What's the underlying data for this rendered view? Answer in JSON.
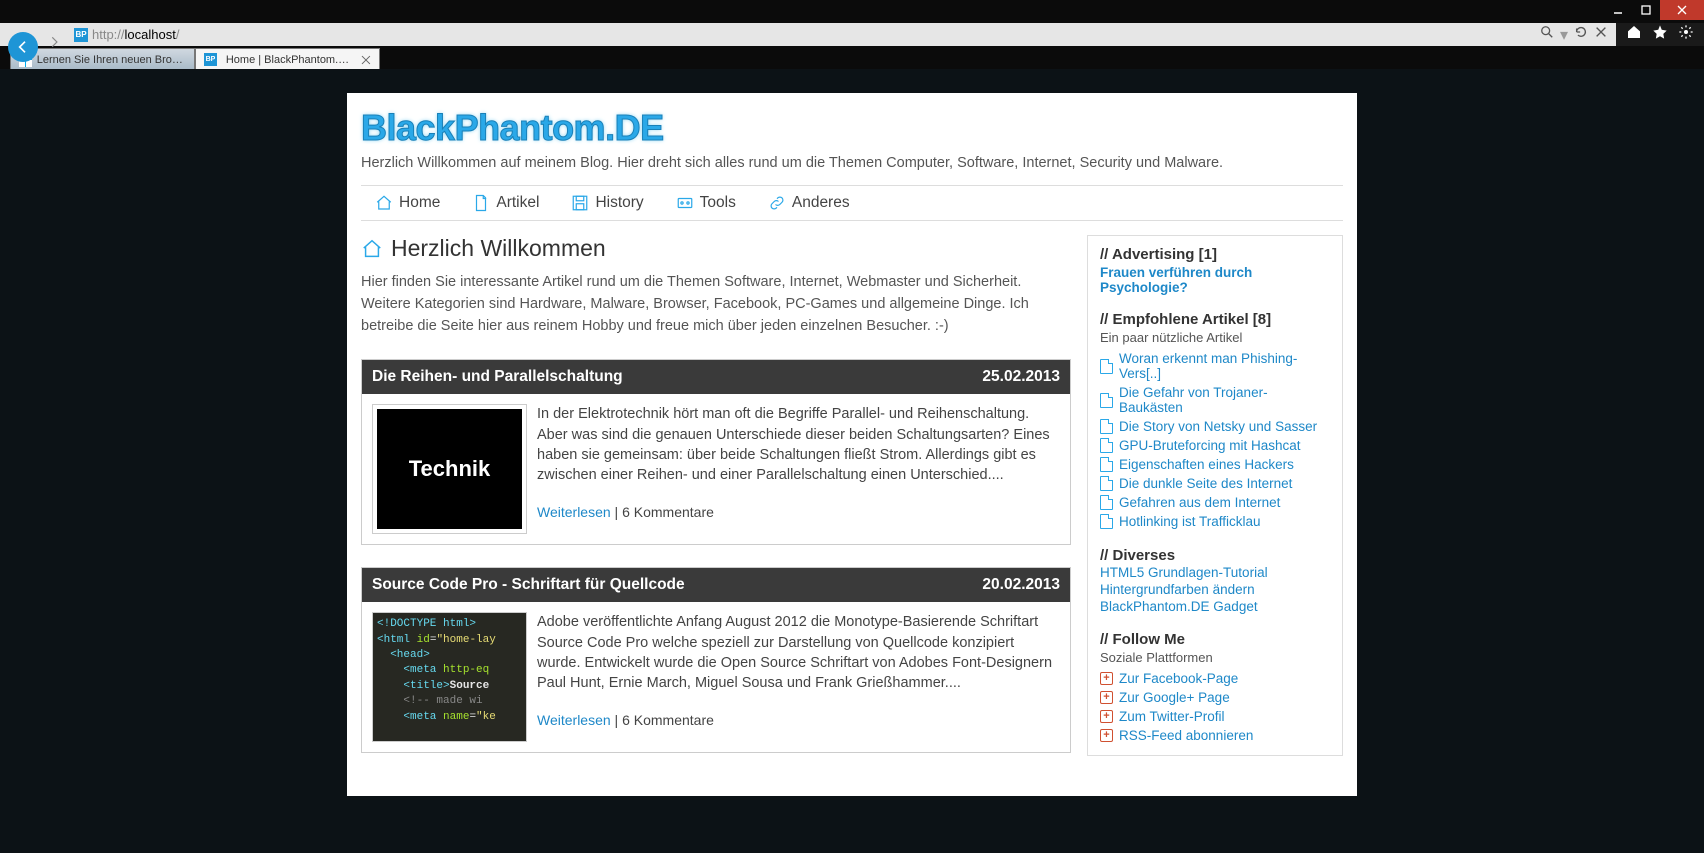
{
  "browser": {
    "url_prefix": "http://",
    "url_host": "localhost",
    "url_suffix": "/",
    "tabs": [
      {
        "label": "Lernen Sie Ihren neuen Browse..."
      },
      {
        "label": "Home | BlackPhantom.DE"
      }
    ],
    "favicon_text": "BP"
  },
  "site": {
    "title": "BlackPhantom.DE",
    "tagline": "Herzlich Willkommen auf meinem Blog. Hier dreht sich alles rund um die Themen Computer, Software, Internet, Security und Malware."
  },
  "nav": {
    "home": "Home",
    "artikel": "Artikel",
    "history": "History",
    "tools": "Tools",
    "anderes": "Anderes"
  },
  "welcome": {
    "heading": "Herzlich Willkommen",
    "text": "Hier finden Sie interessante Artikel rund um die Themen Software, Internet, Webmaster und Sicherheit. Weitere Kategorien sind Hardware, Malware, Browser, Facebook, PC-Games und allgemeine Dinge. Ich betreibe die Seite hier aus reinem Hobby und freue mich über jeden einzelnen Besucher. :-)"
  },
  "articles": [
    {
      "title": "Die Reihen- und Parallelschaltung",
      "date": "25.02.2013",
      "thumb_label": "Technik",
      "excerpt": "In der Elektrotechnik hört man oft die Begriffe Parallel- und Reihenschaltung. Aber was sind die genauen Unterschiede dieser beiden Schaltungsarten? Eines haben sie gemeinsam: über beide Schaltungen fließt Strom. Allerdings gibt es zwischen einer Reihen- und einer Parallel­schaltung einen Unterschied....",
      "more": "Weiterlesen",
      "comments": "6 Kommentare"
    },
    {
      "title": "Source Code Pro - Schriftart für Quellcode",
      "date": "20.02.2013",
      "excerpt": "Adobe veröffentlichte Anfang August 2012 die Monotype-Basierende Schriftart Source Code Pro welche speziell zur Darstellung von Quellcode konzipiert wurde. Entwickelt wurde die Open Source Schriftart von Adobes Font-Designern Paul Hunt, Ernie March, Miguel Sousa und Frank Grießhammer....",
      "more": "Weiterlesen",
      "comments": "6 Kommentare"
    }
  ],
  "sidebar": {
    "advertising": {
      "heading": "// Advertising [1]",
      "link": "Frauen verführen durch Psychologie?"
    },
    "recommended": {
      "heading": "// Empfohlene Artikel [8]",
      "sub": "Ein paar nützliche Artikel",
      "items": [
        "Woran erkennt man Phishing-Vers[..]",
        "Die Gefahr von Trojaner-Baukästen",
        "Die Story von Netsky und Sasser",
        "GPU-Bruteforcing mit Hashcat",
        "Eigenschaften eines Hackers",
        "Die dunkle Seite des Internet",
        "Gefahren aus dem Internet",
        "Hotlinking ist Trafficklau"
      ]
    },
    "diverses": {
      "heading": "// Diverses",
      "items": [
        "HTML5 Grundlagen-Tutorial",
        "Hintergrundfarben ändern",
        "BlackPhantom.DE Gadget"
      ]
    },
    "follow": {
      "heading": "// Follow Me",
      "sub": "Soziale Plattformen",
      "items": [
        "Zur Facebook-Page",
        "Zur Google+ Page",
        "Zum Twitter-Profil",
        "RSS-Feed abonnieren"
      ]
    }
  }
}
